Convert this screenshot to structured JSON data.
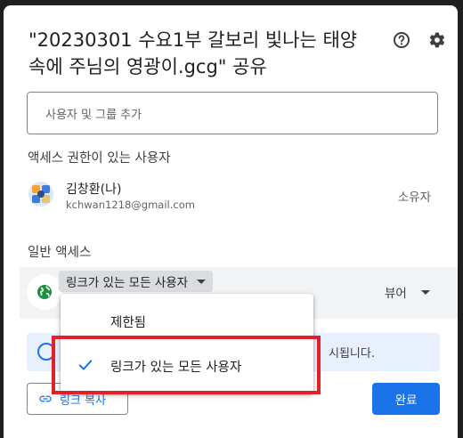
{
  "dialog": {
    "title": "\"20230301 수요1부 갈보리 빛나는 태양\n속에 주님의 영광이.gcg\" 공유",
    "help_icon": "help-circle-icon",
    "settings_icon": "gear-icon"
  },
  "add_people": {
    "placeholder": "사용자 및 그룹 추가"
  },
  "access_section": {
    "label": "액세스 권한이 있는 사용자"
  },
  "user": {
    "name": "김창환(나)",
    "email": "kchwan1218@gmail.com",
    "role": "소유자",
    "avatar_icon": "avatar-image"
  },
  "general_access": {
    "label": "일반 액세스",
    "icon": "globe-icon",
    "link_access": "링크가 있는 모든 사용자",
    "role": "뷰어",
    "accent": "#1e8e3e"
  },
  "info_banner": {
    "text": "시됩니다.",
    "accent": "#1a73e8"
  },
  "footer": {
    "copy_link": "링크 복사",
    "done": "완료"
  },
  "dropdown": {
    "options": [
      {
        "label": "제한됨",
        "selected": false
      },
      {
        "label": "링크가 있는 모든 사용자",
        "selected": true
      }
    ],
    "check_color": "#1a73e8"
  },
  "annotation": {
    "color": "#e2202a"
  }
}
